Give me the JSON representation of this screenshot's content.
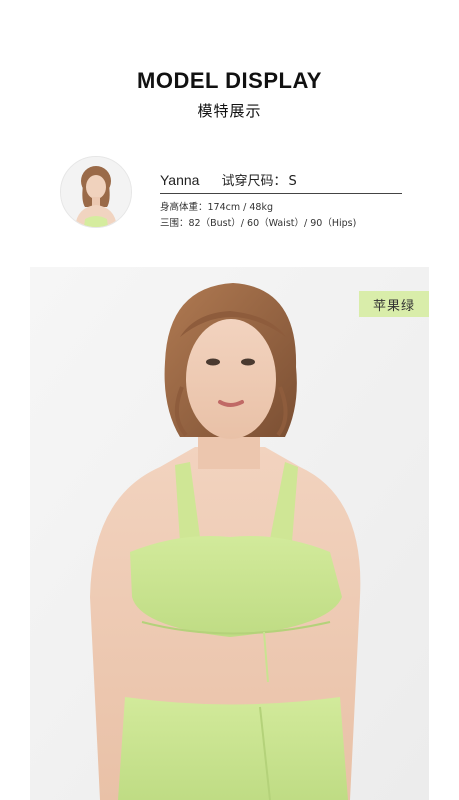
{
  "header": {
    "title": "MODEL DISPLAY",
    "subtitle": "模特展示"
  },
  "model": {
    "name": "Yanna",
    "size_label": "试穿尺码：",
    "size_value": "S",
    "height_weight": "身高体重：174cm / 48kg",
    "measurements": "三围：82（Bust）/ 60（Waist）/ 90（Hips)"
  },
  "product": {
    "color_name": "苹果绿",
    "color_hex": "#c9e391",
    "tag_bg": "#d9edaa"
  }
}
